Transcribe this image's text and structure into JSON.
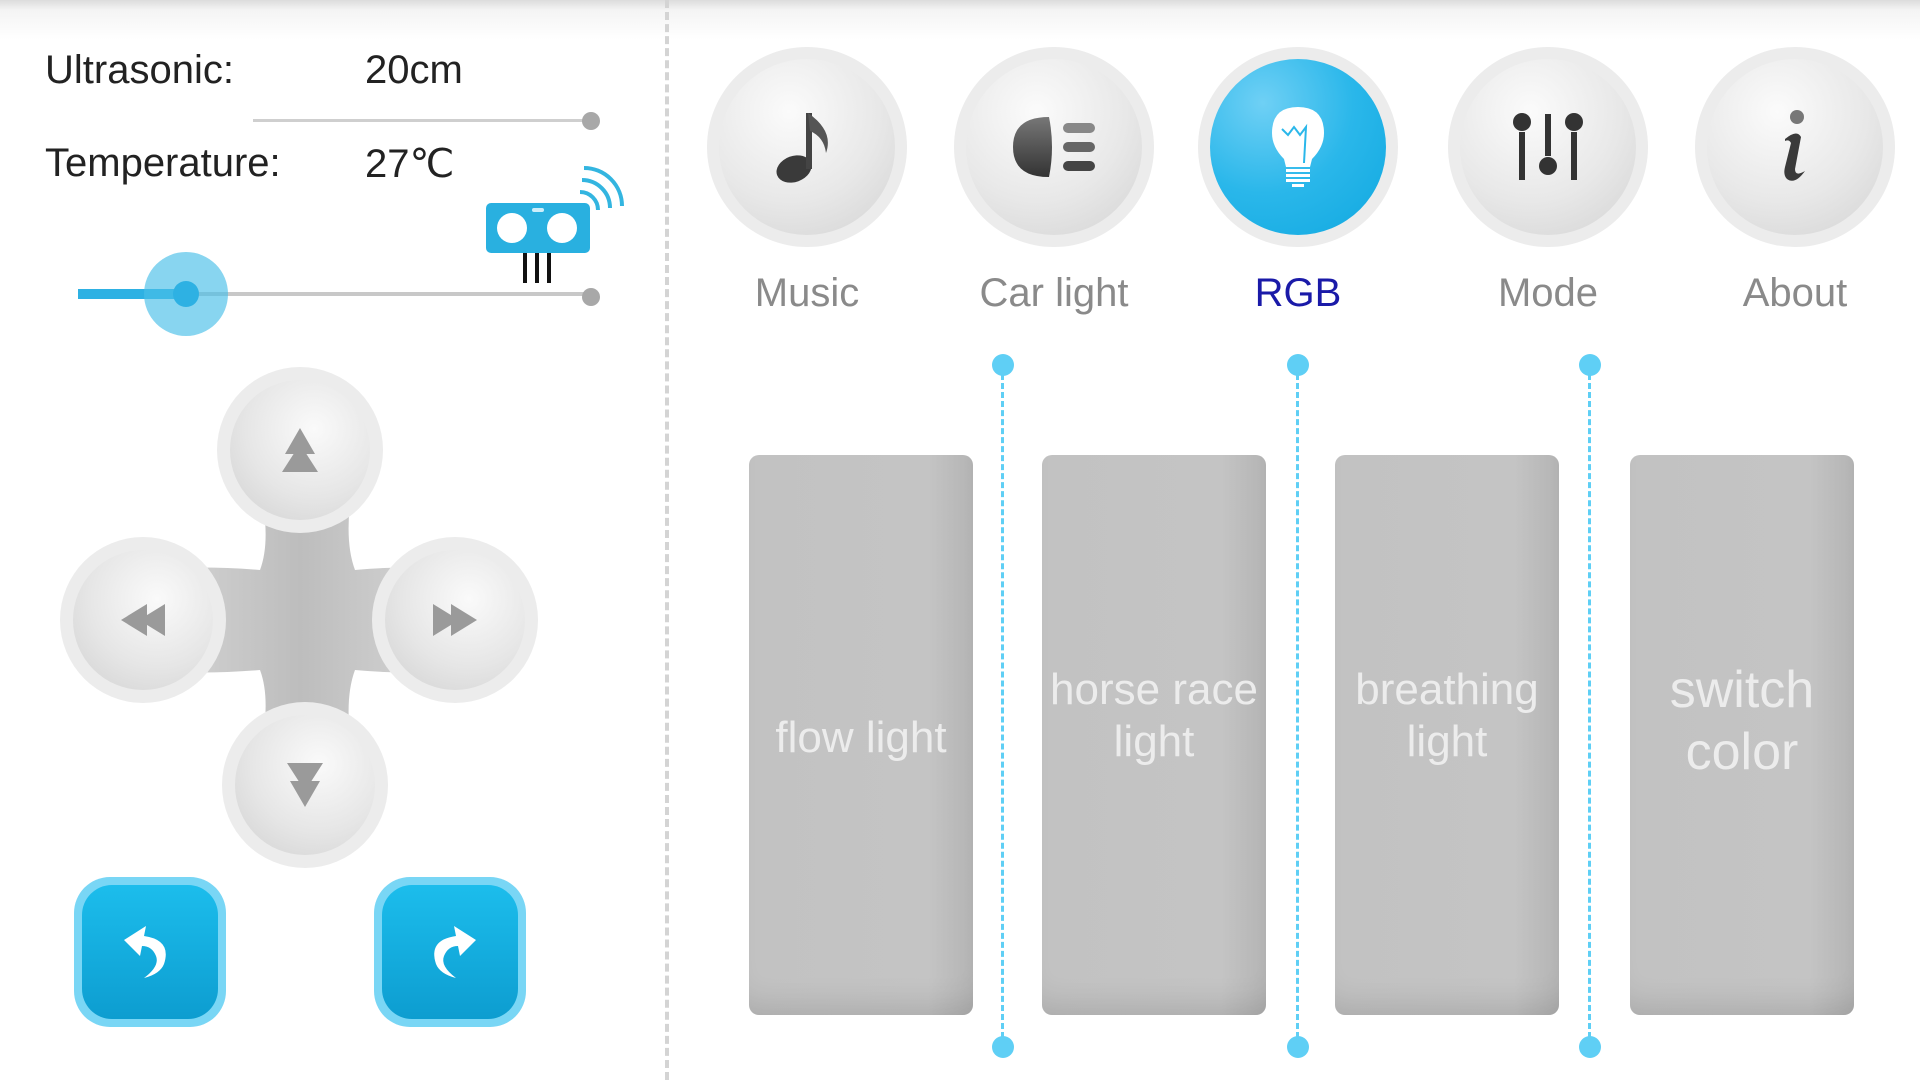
{
  "sensors": {
    "ultrasonic": {
      "label": "Ultrasonic:",
      "value": "20cm"
    },
    "temperature": {
      "label": "Temperature:",
      "value": "27℃"
    }
  },
  "speed_slider": {
    "value_fraction": 0.21
  },
  "icons": {
    "sensor": "ultrasonic-sensor-icon",
    "up": "up-arrow-icon",
    "down": "down-arrow-icon",
    "left": "rewind-icon",
    "right": "fast-forward-icon",
    "turn_left": "turn-left-arrow-icon",
    "turn_right": "turn-right-arrow-icon"
  },
  "tabs": [
    {
      "label": "Music",
      "icon": "music-note-icon",
      "active": false
    },
    {
      "label": "Car light",
      "icon": "headlight-icon",
      "active": false
    },
    {
      "label": "RGB",
      "icon": "light-bulb-icon",
      "active": true
    },
    {
      "label": "Mode",
      "icon": "sliders-icon",
      "active": false
    },
    {
      "label": "About",
      "icon": "info-icon",
      "active": false
    }
  ],
  "rgb_modes": [
    {
      "label": "flow light"
    },
    {
      "label": "horse race light"
    },
    {
      "label": "breathing light"
    },
    {
      "label": "switch color"
    }
  ],
  "colors": {
    "accent": "#2eb1e3",
    "active_tab_text": "#1a1aa8",
    "panel": "#c4c4c4",
    "dashed_line": "#5fcff5"
  }
}
